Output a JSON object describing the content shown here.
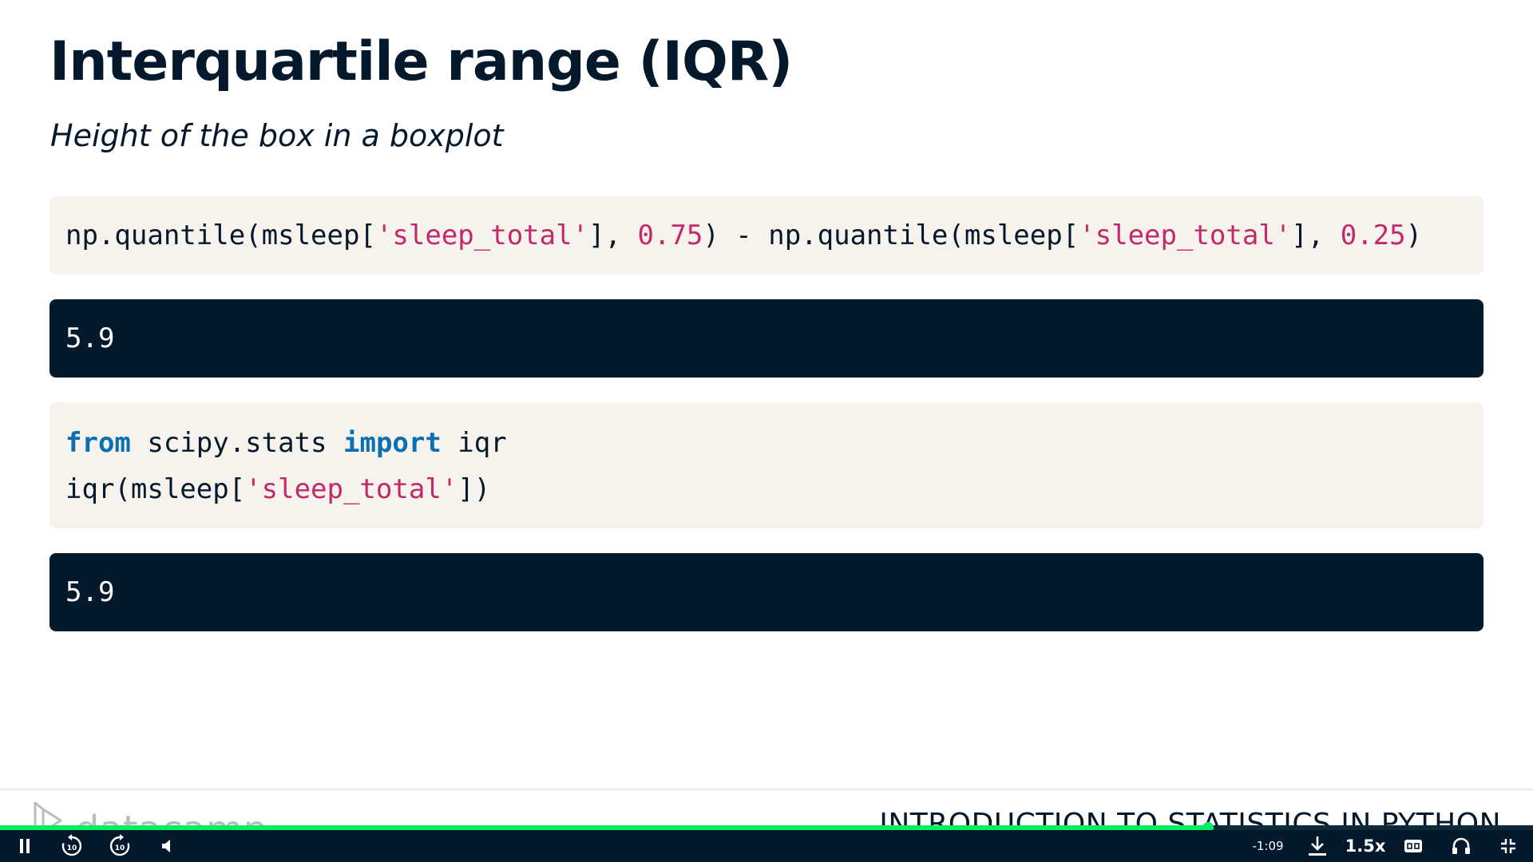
{
  "slide": {
    "title": "Interquartile range (IQR)",
    "subtitle": "Height of the box in a boxplot",
    "code1": {
      "p1": "np.quantile(msleep[",
      "s1": "'sleep_total'",
      "p2": "], ",
      "n1": "0.75",
      "p3": ") - np.quantile(msleep[",
      "s2": "'sleep_total'",
      "p4": "], ",
      "n2": "0.25",
      "p5": ")"
    },
    "output1": "5.9",
    "code2": {
      "line1_kw1": "from",
      "line1_mid": " scipy.stats ",
      "line1_kw2": "import",
      "line1_end": " iqr",
      "line2_a": "iqr(msleep[",
      "line2_str": "'sleep_total'",
      "line2_b": "])"
    },
    "output2": "5.9"
  },
  "footer": {
    "brand": "datacamp",
    "course": "INTRODUCTION TO STATISTICS IN PYTHON"
  },
  "player": {
    "progress_fraction": 0.788,
    "time_remaining": "-1:09",
    "speed": "1.5x",
    "skip_back_seconds": "10",
    "skip_forward_seconds": "10",
    "icons": [
      "pause-icon",
      "rewind-10-icon",
      "forward-10-icon",
      "volume-icon",
      "download-icon",
      "captions-icon",
      "audio-icon",
      "exit-fullscreen-icon"
    ]
  },
  "colors": {
    "navy": "#05192d",
    "code_bg": "#f6f2ec",
    "string": "#c4286b",
    "keyword": "#0a6fb3",
    "progress": "#03ef62"
  }
}
